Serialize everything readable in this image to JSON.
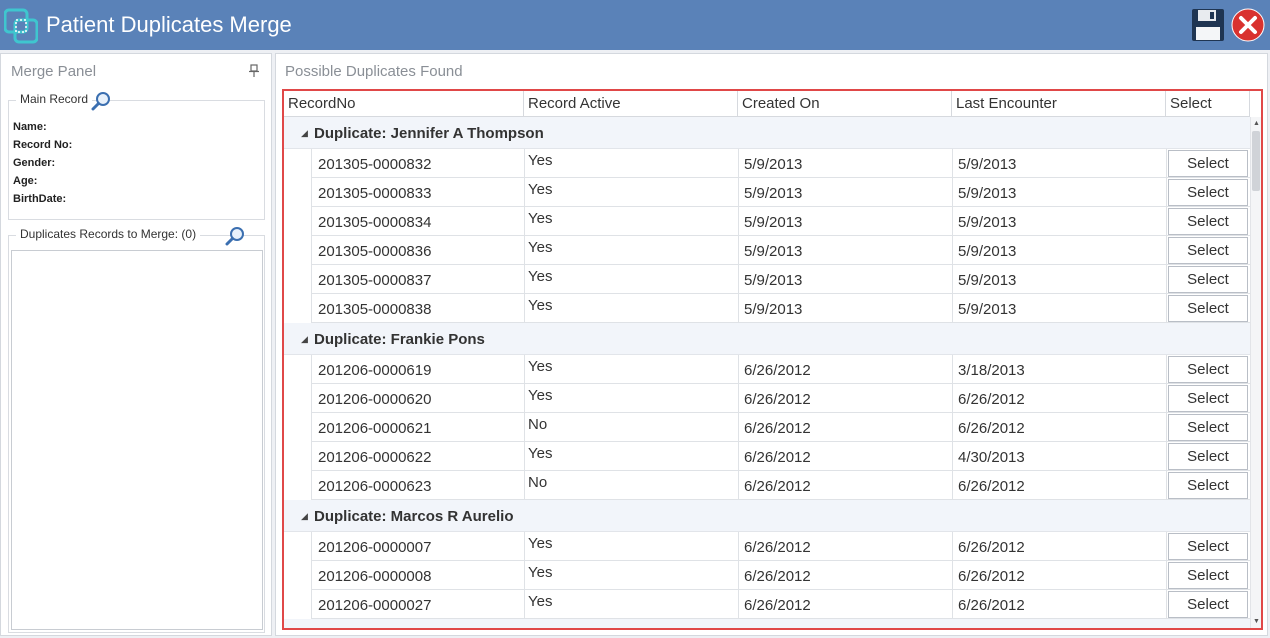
{
  "window": {
    "title": "Patient Duplicates Merge"
  },
  "left_panel": {
    "title": "Merge Panel",
    "main_record": {
      "legend": "Main Record",
      "fields": [
        "Name:",
        "Record No:",
        "Gender:",
        "Age:",
        "BirthDate:"
      ]
    },
    "duplicates_legend": "Duplicates Records to Merge: (0)"
  },
  "right_panel": {
    "title": "Possible Duplicates Found",
    "columns": [
      "RecordNo",
      "Record Active",
      "Created On",
      "Last Encounter",
      "Select"
    ],
    "button_label": "Select",
    "groups": [
      {
        "label": "Duplicate: Jennifer A Thompson",
        "rows": [
          {
            "record_no": "201305-0000832",
            "active": "Yes",
            "created": "5/9/2013",
            "last": "5/9/2013"
          },
          {
            "record_no": "201305-0000833",
            "active": "Yes",
            "created": "5/9/2013",
            "last": "5/9/2013"
          },
          {
            "record_no": "201305-0000834",
            "active": "Yes",
            "created": "5/9/2013",
            "last": "5/9/2013"
          },
          {
            "record_no": "201305-0000836",
            "active": "Yes",
            "created": "5/9/2013",
            "last": "5/9/2013"
          },
          {
            "record_no": "201305-0000837",
            "active": "Yes",
            "created": "5/9/2013",
            "last": "5/9/2013"
          },
          {
            "record_no": "201305-0000838",
            "active": "Yes",
            "created": "5/9/2013",
            "last": "5/9/2013"
          }
        ]
      },
      {
        "label": "Duplicate: Frankie Pons",
        "rows": [
          {
            "record_no": "201206-0000619",
            "active": "Yes",
            "created": "6/26/2012",
            "last": "3/18/2013"
          },
          {
            "record_no": "201206-0000620",
            "active": "Yes",
            "created": "6/26/2012",
            "last": "6/26/2012"
          },
          {
            "record_no": "201206-0000621",
            "active": "No",
            "created": "6/26/2012",
            "last": "6/26/2012"
          },
          {
            "record_no": "201206-0000622",
            "active": "Yes",
            "created": "6/26/2012",
            "last": "4/30/2013"
          },
          {
            "record_no": "201206-0000623",
            "active": "No",
            "created": "6/26/2012",
            "last": "6/26/2012"
          }
        ]
      },
      {
        "label": "Duplicate: Marcos R Aurelio",
        "rows": [
          {
            "record_no": "201206-0000007",
            "active": "Yes",
            "created": "6/26/2012",
            "last": "6/26/2012"
          },
          {
            "record_no": "201206-0000008",
            "active": "Yes",
            "created": "6/26/2012",
            "last": "6/26/2012"
          },
          {
            "record_no": "201206-0000027",
            "active": "Yes",
            "created": "6/26/2012",
            "last": "6/26/2012"
          }
        ]
      }
    ]
  },
  "icons": {
    "app": "patient-merge-logo",
    "save": "floppy-disk-icon",
    "close": "close-icon",
    "pin": "pin-icon",
    "search": "magnifier-icon",
    "expand": "collapse-triangle-icon"
  },
  "colors": {
    "titlebar": "#5a82b8",
    "highlight_border": "#e04848",
    "group_row_bg": "#f2f5fa",
    "close_red": "#d9322f"
  }
}
